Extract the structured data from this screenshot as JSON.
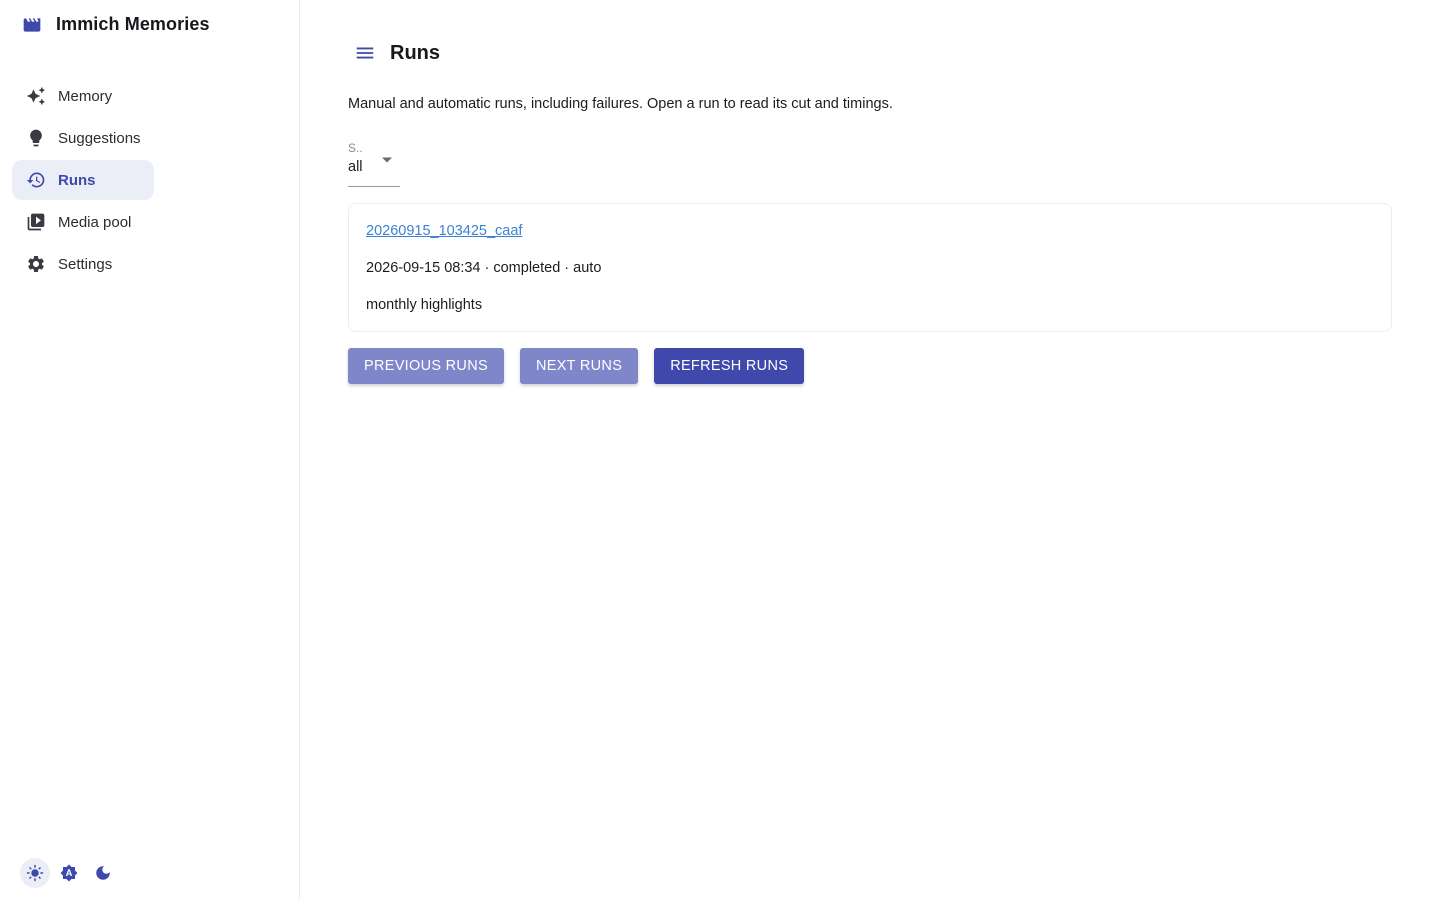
{
  "app": {
    "title": "Immich Memories"
  },
  "sidebar": {
    "items": [
      {
        "label": "Memory",
        "icon": "sparkles-icon"
      },
      {
        "label": "Suggestions",
        "icon": "lightbulb-icon"
      },
      {
        "label": "Runs",
        "icon": "history-icon",
        "active": true
      },
      {
        "label": "Media pool",
        "icon": "video-library-icon"
      },
      {
        "label": "Settings",
        "icon": "gear-icon"
      }
    ],
    "theme_modes": [
      {
        "icon": "sun-icon",
        "active": true
      },
      {
        "icon": "auto-theme-icon",
        "active": false
      },
      {
        "icon": "moon-icon",
        "active": false
      }
    ]
  },
  "page": {
    "title": "Runs",
    "description": "Manual and automatic runs, including failures. Open a run to read its cut and timings.",
    "status_filter": {
      "label": "S..",
      "value": "all"
    }
  },
  "runs": [
    {
      "id": "20260915_103425_caaf",
      "meta": "2026-09-15 08:34 · completed · auto",
      "name": "monthly highlights"
    }
  ],
  "actions": {
    "previous": "PREVIOUS RUNS",
    "next": "NEXT RUNS",
    "refresh": "REFRESH RUNS"
  },
  "colors": {
    "accent": "#3f48ab",
    "accent_light": "#7f86c9",
    "link": "#3b82d6",
    "active_bg": "#eceef7"
  }
}
